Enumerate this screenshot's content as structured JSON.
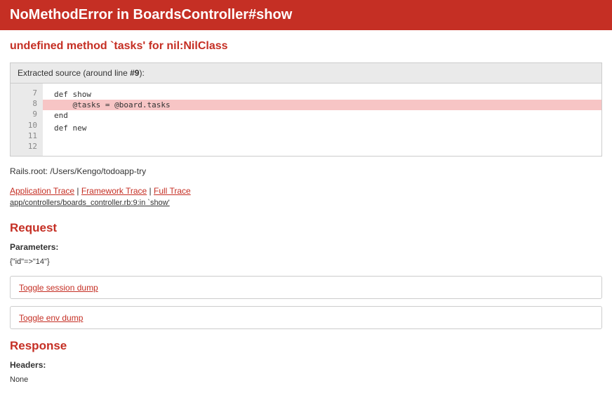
{
  "header_title": "NoMethodError in BoardsController#show",
  "exception_message": "undefined method `tasks' for nil:NilClass",
  "source": {
    "heading_prefix": "Extracted source (around line ",
    "heading_line": "#9",
    "heading_suffix": "):",
    "lines": [
      {
        "num": "7",
        "code": ""
      },
      {
        "num": "8",
        "code": "def show"
      },
      {
        "num": "9",
        "code": "    @tasks = @board.tasks",
        "highlight": true
      },
      {
        "num": "10",
        "code": "end"
      },
      {
        "num": "11",
        "code": ""
      },
      {
        "num": "12",
        "code": "def new"
      }
    ]
  },
  "rails_root": "Rails.root: /Users/Kengo/todoapp-try",
  "traces": {
    "app": "Application Trace",
    "framework": "Framework Trace",
    "full": "Full Trace",
    "sep": " | "
  },
  "trace_line": "app/controllers/boards_controller.rb:9:in `show'",
  "request": {
    "heading": "Request",
    "parameters_label": "Parameters",
    "parameters_colon": ":",
    "parameters_value": "{\"id\"=>\"14\"}",
    "toggle_session": "Toggle session dump",
    "toggle_env": "Toggle env dump"
  },
  "response": {
    "heading": "Response",
    "headers_label": "Headers",
    "headers_colon": ":",
    "headers_value": "None"
  }
}
